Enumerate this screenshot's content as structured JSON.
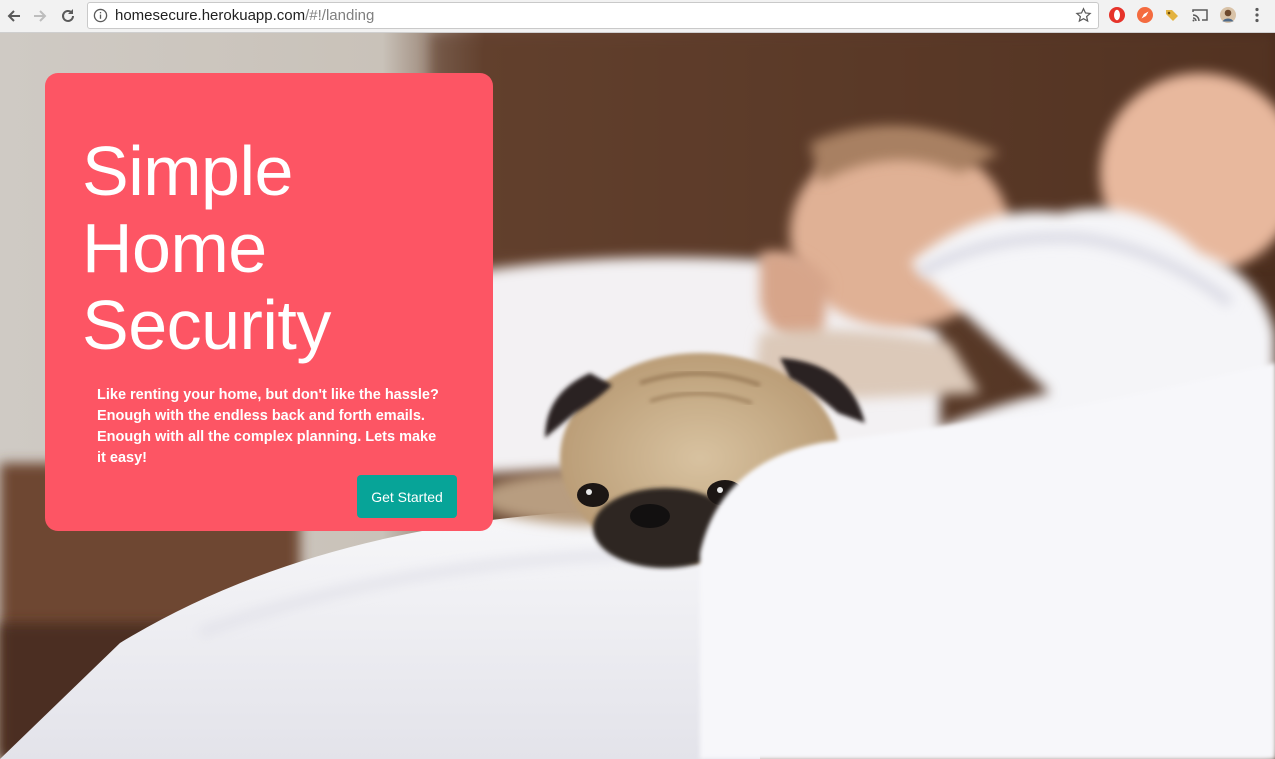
{
  "browser": {
    "url_host": "homesecure.herokuapp.com",
    "url_path": "/#!/landing"
  },
  "icons": {
    "back": "back-arrow-icon",
    "forward": "forward-arrow-icon",
    "reload": "reload-icon",
    "info": "info-icon",
    "bookmark": "star-icon",
    "ext_opera": "opera-extension-icon",
    "ext_compass": "compass-extension-icon",
    "ext_tag": "tag-extension-icon",
    "cast": "cast-icon",
    "profile": "profile-avatar-icon",
    "menu": "more-vertical-icon"
  },
  "hero": {
    "title_line1": "Simple",
    "title_line2": "Home",
    "title_line3": "Security",
    "description": "Like renting your home, but don't like the hassle? Enough with the endless back and forth emails. Enough with all the complex planning. Lets make it easy!",
    "cta_label": "Get Started"
  },
  "colors": {
    "card_bg": "#fd5564",
    "cta_bg": "#07a498",
    "text": "#ffffff"
  }
}
